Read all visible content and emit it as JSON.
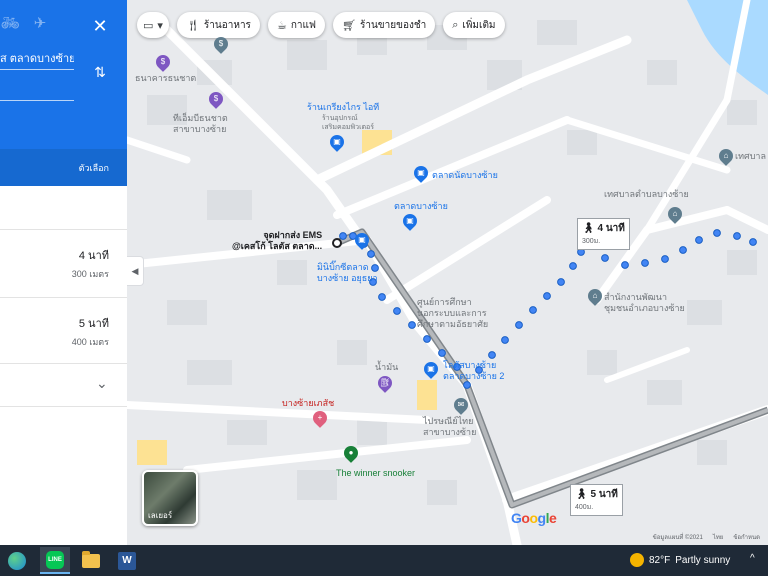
{
  "panel": {
    "destination_value": "ส ตลาดบางซ้าย",
    "options_label": "ตัวเลือก",
    "close_glyph": "✕",
    "routes": [
      {
        "time": "4 นาที",
        "distance": "300 เมตร"
      },
      {
        "time": "5 นาที",
        "distance": "400 เมตร"
      }
    ]
  },
  "chips": [
    {
      "icon": "fork-knife-icon",
      "label": "ร้านอาหาร"
    },
    {
      "icon": "coffee-icon",
      "label": "กาแฟ"
    },
    {
      "icon": "cart-icon",
      "label": "ร้านขายของชำ"
    },
    {
      "icon": "search-icon",
      "label": "เพิ่มเติม"
    }
  ],
  "map_labels": {
    "bank": "ธนาคารธนชาต",
    "atm": "ทีเอ็มบีธนชาต\nสาขาบางซ้าย",
    "shop": "ร้านเกรียงไกร ไอที",
    "shop_sub": "ร้านอุปกรณ์\nเสริมคอมพิวเตอร์",
    "market1": "ตลาดนัดบางซ้าย",
    "market2": "ตลาดบางซ้าย",
    "ems": "จุดฝากส่ง EMS\n@เคสโก้ โลตัส ตลาด...",
    "minibigc": "มินิบิ๊กซีตลาด\nบางซ้าย อยุธยา",
    "school": "ศูนย์การศึกษา\nนอกระบบและการ\nศึกษาตามอัธยาศัย",
    "lotus": "โลตัสบางซ้าย\nตลาดบางซ้าย 2",
    "oil": "น้ำมัน",
    "bangsai_shop": "บางซ้ายเภสัช",
    "post": "ไปรษณีย์ไทย\nสาขาบางซ้าย",
    "snooker": "The winner snooker",
    "municipality": "เทศบาลตำบลบางซ้าย",
    "community": "สำนักงานพัฒนา\nชุมชนอำเภอบางซ้าย",
    "muni_edge": "เทศบาล"
  },
  "time_labels": [
    {
      "time": "4 นาที",
      "distance": "300ม."
    },
    {
      "time": "5 นาที",
      "distance": "400ม."
    }
  ],
  "layers_label": "เลเยอร์",
  "google": "Google",
  "copyright": [
    "ข้อมูลแผนที่ ©2021",
    "ไทย",
    "ข้อกำหนด"
  ],
  "taskbar": {
    "temperature": "82°F",
    "condition": "Partly sunny"
  },
  "colors": {
    "accent": "#1a73e8",
    "route_dots": "#4285f4",
    "route_grey": "#8e9194"
  }
}
